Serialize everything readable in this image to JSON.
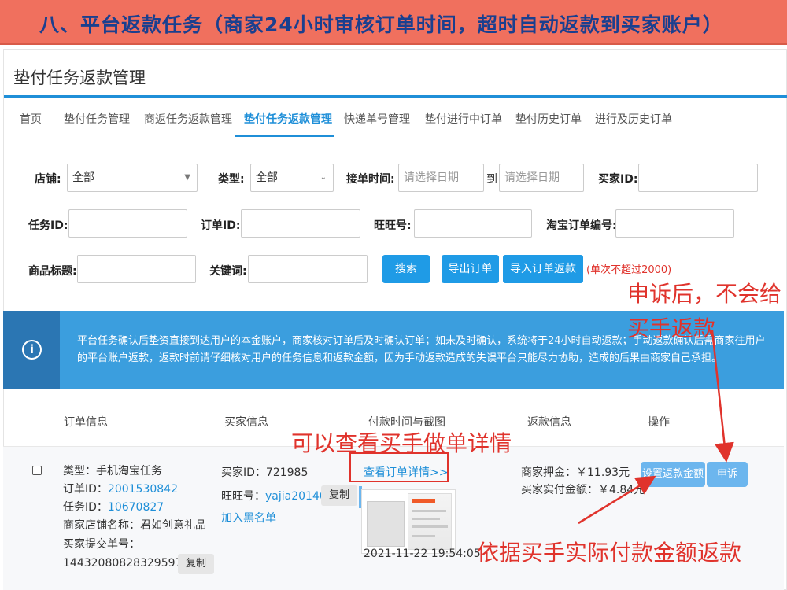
{
  "banner": {
    "title": "八、平台返款任务（商家24小时审核订单时间，超时自动返款到买家账户）"
  },
  "page": {
    "title": "垫付任务返款管理"
  },
  "nav": {
    "items": [
      {
        "label": "首页"
      },
      {
        "label": "垫付任务管理"
      },
      {
        "label": "商返任务返款管理"
      },
      {
        "label": "垫付任务返款管理"
      },
      {
        "label": "快递单号管理"
      },
      {
        "label": "垫付进行中订单"
      },
      {
        "label": "垫付历史订单"
      },
      {
        "label": "进行及历史订单"
      }
    ],
    "active": "垫付任务返款管理"
  },
  "filters": {
    "store_label": "店铺:",
    "store_value": "全部",
    "type_label": "类型:",
    "type_value": "全部",
    "time_label": "接单时间:",
    "date_placeholder": "请选择日期",
    "to_label": "到",
    "buyer_id_label": "买家ID:",
    "task_id_label": "任务ID:",
    "order_id_label": "订单ID:",
    "wangwang_label": "旺旺号:",
    "taobao_order_label": "淘宝订单编号:",
    "product_title_label": "商品标题:",
    "keyword_label": "关键词:"
  },
  "buttons": {
    "search": "搜索",
    "export": "导出订单",
    "import": "导入订单返款",
    "limit_note": "(单次不超过2000)"
  },
  "notice": {
    "icon": "info-icon",
    "text": "平台任务确认后垫资直接到达用户的本金账户，商家核对订单后及时确认订单；如未及时确认，系统将于24小时自动返款；手动返款确认后需商家往用户的平台账户返款，返款时前请仔细核对用户的任务信息和返款金额，因为手动返款造成的失误平台只能尽力协助，造成的后果由商家自己承担。"
  },
  "table": {
    "headers": [
      "订单信息",
      "买家信息",
      "付款时间与截图",
      "返款信息",
      "操作"
    ],
    "row": {
      "type": "类型：手机淘宝任务",
      "order_id_label": "订单ID：",
      "order_id": "2001530842",
      "task_id_label": "任务ID：",
      "task_id": "10670827",
      "shop_name": "商家店铺名称：君如创意礼品",
      "buyer_order_label": "买家提交单号：",
      "buyer_order_no": "1443208082832959791",
      "copy": "复制",
      "buyer_id": "买家ID：721985",
      "wangwang_label": "旺旺号：",
      "wangwang": "yajia201401",
      "blacklist": "加入黑名单",
      "view_detail": "查看订单详情>>",
      "pay_time": "2021-11-22 19:54:05",
      "deposit": "商家押金：￥11.93元",
      "actual_pay": "买家实付金额：￥4.84元",
      "set_refund": "设置返款金额",
      "appeal": "申诉"
    }
  },
  "annotations": {
    "appeal_note_1": "申诉后，不会给",
    "appeal_note_2": "买手返款",
    "view_note": "可以查看买手做单详情",
    "refund_note": "依据买手实际付款金额返款",
    "color": "#e0332c"
  },
  "colors": {
    "primary": "#1f8fd8",
    "banner": "#f0705e",
    "notice": "#3b9ede"
  }
}
